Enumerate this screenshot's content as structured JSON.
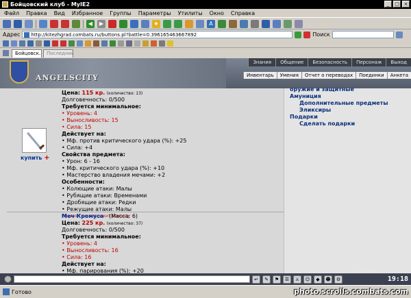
{
  "window": {
    "title": "Бойцовский клуб - MyIE2"
  },
  "menu": [
    "Файл",
    "Правка",
    "Вид",
    "Избранное",
    "Группы",
    "Параметры",
    "Утилиты",
    "Окно",
    "Справка"
  ],
  "address": {
    "label": "Адрес",
    "url": "http://kitezhgrad.combats.ru/buttons.pl?battle=0.396165463667892",
    "search_label": "Поиск"
  },
  "tabs": [
    {
      "label": "Бойцовск...",
      "active": true
    },
    {
      "label": "Последний д...",
      "active": false
    }
  ],
  "game": {
    "logo_text": "ANGELSCITY",
    "nav_top": [
      "Знания",
      "Общение",
      "Безопасность",
      "Персонаж",
      "Выход"
    ],
    "nav_sub": [
      "Инвентарь",
      "Умения",
      "Отчет о переводах",
      "Поединки",
      "Анкета"
    ]
  },
  "item1": {
    "buy": "купить",
    "price_label": "Цена:",
    "price_value": "115 кр.",
    "qty": "(количество: 13)",
    "durability": "Долговечность: 0/500",
    "req_heading": "Требуется минимальное:",
    "reqs": [
      "Уровень: 4",
      "Выносливость: 15",
      "Сила: 15"
    ],
    "acts_heading": "Действует на:",
    "acts": [
      "Мф. против критического удара (%): +25",
      "Сила: +4"
    ],
    "props_heading": "Свойства предмета:",
    "props": [
      "Урон: 6 - 16",
      "Мф. критического удара (%): +10",
      "Мастерство владения мечами: +2"
    ],
    "features_heading": "Особенности:",
    "features": [
      "Колющие атаки: Малы",
      "Рубящие атаки: Временами",
      "Дробящие атаки: Редки",
      "Режущие атаки: Малы"
    ],
    "note": "Предмет не подлежит ремонту"
  },
  "item2": {
    "name": "Меч Кромуса",
    "mass": "(Масса: 6)",
    "price_label": "Цена:",
    "price_value": "225 кр.",
    "qty": "(количество: 37)",
    "durability": "Долговечность: 0/500",
    "req_heading": "Требуется минимальное:",
    "reqs": [
      "Уровень: 4",
      "Выносливость: 16",
      "Сила: 16"
    ],
    "acts_heading": "Действует на:",
    "acts_partial": "Мф. парирования (%): +20"
  },
  "categories": [
    {
      "label": "оружие и защитные",
      "indent": false
    },
    {
      "label": "Амуниция",
      "indent": false
    },
    {
      "label": "Дополнительные предметы",
      "indent": true
    },
    {
      "label": "Эликсиры",
      "indent": true
    },
    {
      "label": "Подарки",
      "indent": false
    },
    {
      "label": "Сделать подарки",
      "indent": true
    }
  ],
  "chat": {
    "refresh_label": "Обновить",
    "clock": "19:18"
  },
  "status": {
    "text": "Готово",
    "watermark": "photo.scrolls.combats.com"
  }
}
